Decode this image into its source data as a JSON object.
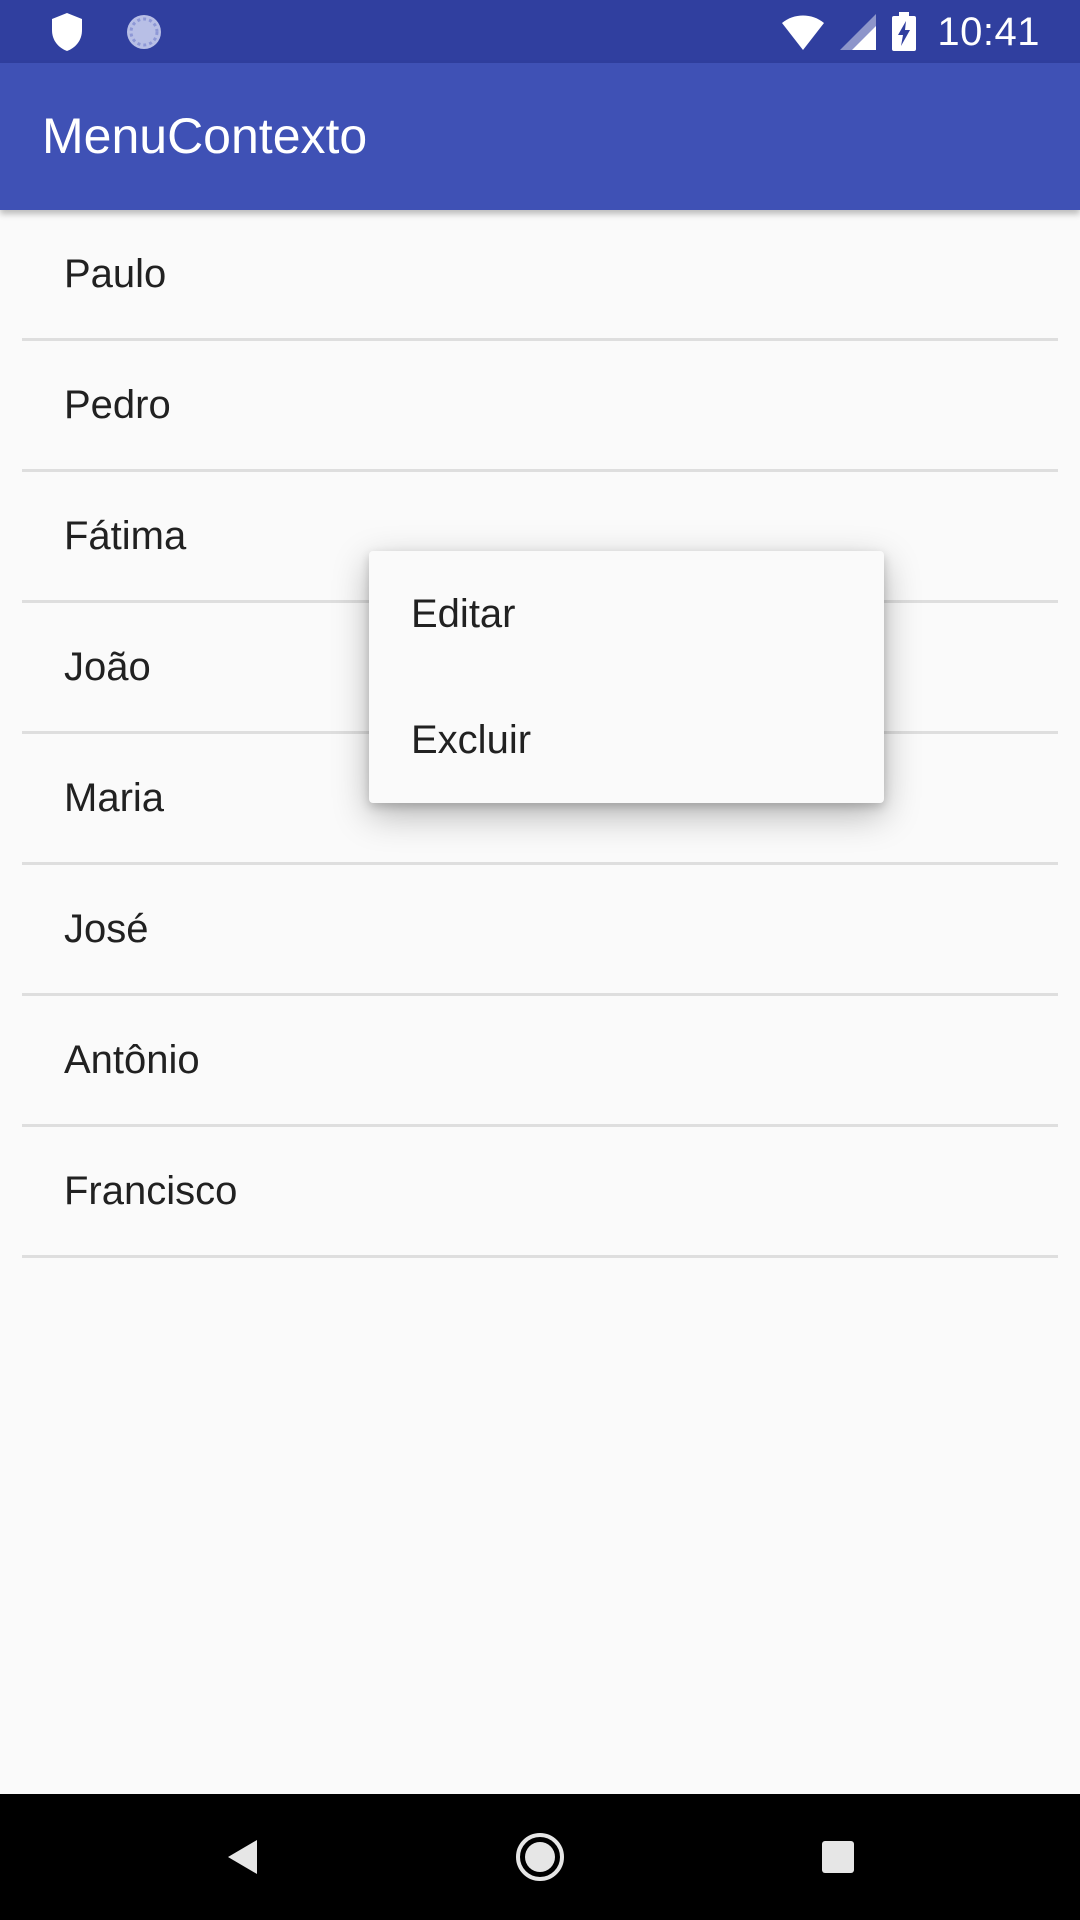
{
  "status_bar": {
    "time": "10:41",
    "icons": [
      "shield-icon",
      "sync-icon",
      "wifi-icon",
      "signal-icon",
      "battery-charging-icon"
    ]
  },
  "app_bar": {
    "title": "MenuContexto"
  },
  "list": {
    "items": [
      {
        "label": "Paulo"
      },
      {
        "label": "Pedro"
      },
      {
        "label": "Fátima"
      },
      {
        "label": "João"
      },
      {
        "label": "Maria"
      },
      {
        "label": "José"
      },
      {
        "label": "Antônio"
      },
      {
        "label": "Francisco"
      }
    ]
  },
  "context_menu": {
    "items": [
      {
        "label": "Editar"
      },
      {
        "label": "Excluir"
      }
    ]
  },
  "nav_bar": {
    "icons": [
      "back-icon",
      "home-icon",
      "recents-icon"
    ]
  },
  "colors": {
    "status_bar": "#303f9f",
    "app_bar": "#3f51b5",
    "background": "#fafafa",
    "divider": "#dedede",
    "text": "#212121"
  }
}
